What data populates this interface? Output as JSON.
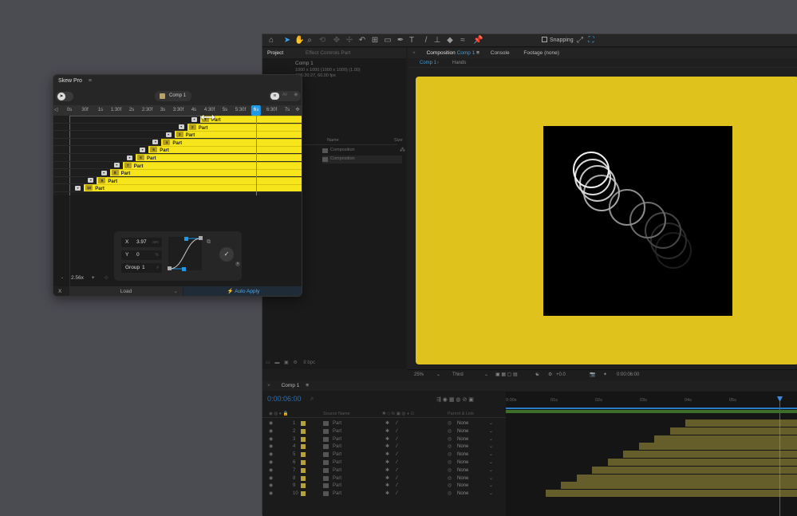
{
  "skew_pro": {
    "title": "Skew Pro",
    "comp_selector": "Comp 1",
    "ruler_ticks": [
      "0s",
      "30f",
      "1s",
      "1:30f",
      "2s",
      "2:30f",
      "3s",
      "3:30f",
      "4s",
      "4:30f",
      "5s",
      "5:30f",
      "6s",
      "6:30f",
      "7s"
    ],
    "current_time_tick": "6s",
    "layers": [
      {
        "index": "1",
        "label": "Part"
      },
      {
        "index": "2",
        "label": "Part"
      },
      {
        "index": "3",
        "label": "Part"
      },
      {
        "index": "4",
        "label": "Part"
      },
      {
        "index": "5",
        "label": "Part"
      },
      {
        "index": "6",
        "label": "Part"
      },
      {
        "index": "7",
        "label": "Part"
      },
      {
        "index": "8",
        "label": "Part"
      },
      {
        "index": "9",
        "label": "Part"
      },
      {
        "index": "10",
        "label": "Part"
      }
    ],
    "x_label": "X",
    "x_value": "3.97",
    "x_unit": "sec",
    "y_label": "Y",
    "y_value": "0",
    "y_unit": "%",
    "group_label": "Group",
    "group_value": "1",
    "zoom_minus": "-",
    "zoom_value": "2.56x",
    "zoom_plus": "+",
    "bottom_close": "X",
    "load_label": "Load",
    "auto_apply_label": "Auto Apply"
  },
  "ae": {
    "snapping_label": "Snapping",
    "project_tab": "Project",
    "effect_controls_tab": "Effect Controls Part",
    "project_comp_name": "Comp 1",
    "project_comp_info1": "1000 x 1000 (1000 x 1000) (1.00)",
    "project_comp_info2": "Δ06:20:27, 60.00 fps",
    "project_col_name": "Name",
    "project_col_size": "Size",
    "project_items": [
      "Composition",
      "Composition"
    ],
    "composition_tab": "Composition",
    "composition_tab_comp": "Comp 1",
    "console_tab": "Console",
    "footage_tab": "Footage (none)",
    "subtab_comp": "Comp 1",
    "subtab_hands": "Hands",
    "viewer_zoom": "25%",
    "viewer_quality": "Third",
    "viewer_exposure": "+0.0",
    "viewer_time": "0:00:06:00",
    "bpc": "8 bpc",
    "timeline_tab": "Comp 1",
    "timeline_time": "0:00:06:00",
    "timeline_col_source": "Source Name",
    "timeline_col_parent": "Parent & Link",
    "timeline_ruler": [
      "0:00s",
      "01s",
      "02s",
      "03s",
      "04s",
      "05s"
    ],
    "timeline_rows": [
      {
        "num": "1",
        "name": "Part",
        "parent": "None"
      },
      {
        "num": "2",
        "name": "Part",
        "parent": "None"
      },
      {
        "num": "3",
        "name": "Part",
        "parent": "None"
      },
      {
        "num": "4",
        "name": "Part",
        "parent": "None"
      },
      {
        "num": "5",
        "name": "Part",
        "parent": "None"
      },
      {
        "num": "6",
        "name": "Part",
        "parent": "None"
      },
      {
        "num": "7",
        "name": "Part",
        "parent": "None"
      },
      {
        "num": "8",
        "name": "Part",
        "parent": "None"
      },
      {
        "num": "9",
        "name": "Part",
        "parent": "None"
      },
      {
        "num": "10",
        "name": "Part",
        "parent": "None"
      }
    ]
  },
  "colors": {
    "accent_yellow": "#f5e51a",
    "comp_background": "#e0c21c",
    "accent_blue": "#1e9be8"
  }
}
